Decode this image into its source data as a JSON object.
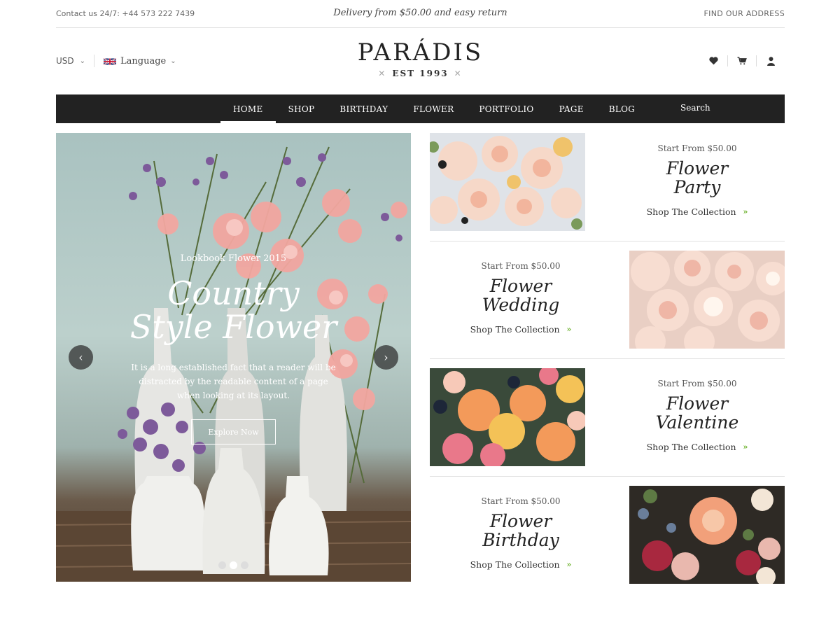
{
  "topbar": {
    "contact": "Contact us 24/7: +44 573 222 7439",
    "promo": "Delivery from $50.00 and easy return",
    "address_link": "FIND OUR ADDRESS"
  },
  "header": {
    "currency": "USD",
    "language": "Language",
    "logo": "PARÁDIS",
    "est": "EST 1993",
    "icons": [
      "heart-icon",
      "cart-icon",
      "user-icon"
    ]
  },
  "nav": {
    "items": [
      "HOME",
      "SHOP",
      "BIRTHDAY",
      "FLOWER",
      "PORTFOLIO",
      "PAGE",
      "BLOG"
    ],
    "active": "HOME",
    "search": "Search"
  },
  "hero": {
    "subtitle": "Lookbook Flower 2015",
    "title_line1": "Country",
    "title_line2": "Style Flower",
    "description": "It is a long established fact that a reader will be distracted by the readable content of a page when looking at its layout.",
    "button": "Explore Now",
    "slides": 3,
    "active_slide": 2
  },
  "collections": [
    {
      "price": "Start From $50.00",
      "name_line1": "Flower",
      "name_line2": "Party",
      "link": "Shop The Collection"
    },
    {
      "price": "Start From $50.00",
      "name_line1": "Flower",
      "name_line2": "Wedding",
      "link": "Shop The Collection"
    },
    {
      "price": "Start From $50.00",
      "name_line1": "Flower",
      "name_line2": "Valentine",
      "link": "Shop The Collection"
    },
    {
      "price": "Start From $50.00",
      "name_line1": "Flower",
      "name_line2": "Birthday",
      "link": "Shop The Collection"
    }
  ],
  "colors": {
    "nav_bg": "#222222",
    "accent_green": "#6bb12b",
    "text": "#333333"
  }
}
